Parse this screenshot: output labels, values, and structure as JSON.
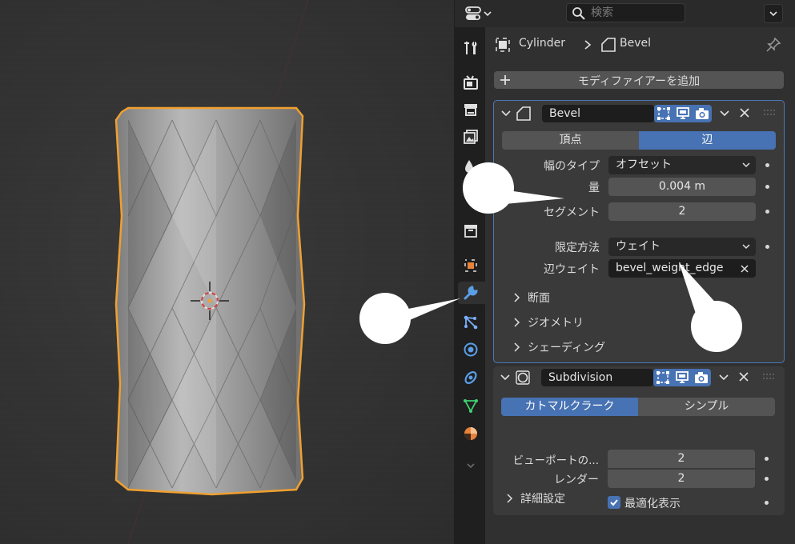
{
  "header": {
    "search_placeholder": "検索"
  },
  "breadcrumb": {
    "object": "Cylinder",
    "modifier": "Bevel"
  },
  "add_modifier_label": "モディファイアーを追加",
  "bevel": {
    "name": "Bevel",
    "mode_vertices": "頂点",
    "mode_edges": "辺",
    "width_type_label": "幅のタイプ",
    "width_type_value": "オフセット",
    "amount_label": "量",
    "amount_value": "0.004 m",
    "segments_label": "セグメント",
    "segments_value": "2",
    "limit_method_label": "限定方法",
    "limit_method_value": "ウェイト",
    "edge_weight_label": "辺ウェイト",
    "edge_weight_value": "bevel_weight_edge",
    "sub_profile": "断面",
    "sub_geometry": "ジオメトリ",
    "sub_shading": "シェーディング"
  },
  "subdivision": {
    "name": "Subdivision",
    "mode_catmull": "カトマルクラーク",
    "mode_simple": "シンプル",
    "viewport_levels_label": "ビューポートの...",
    "viewport_levels_value": "2",
    "render_label": "レンダー",
    "render_value": "2",
    "optimal_display_label": "最適化表示",
    "optimal_display_checked": true,
    "advanced": "詳細設定"
  },
  "tabs": [
    "tool-icon",
    "render-icon",
    "output-icon",
    "view-layer-icon",
    "scene-icon",
    "world-icon",
    "collection-icon",
    "object-icon",
    "modifier-icon",
    "particles-icon",
    "physics-icon",
    "constraints-icon",
    "data-icon",
    "material-icon",
    "more-icon"
  ],
  "colors": {
    "accent": "#4772b3",
    "selection_outline": "#f0a030",
    "panel_bg": "#3a3a3a",
    "editor_bg": "#303030"
  }
}
